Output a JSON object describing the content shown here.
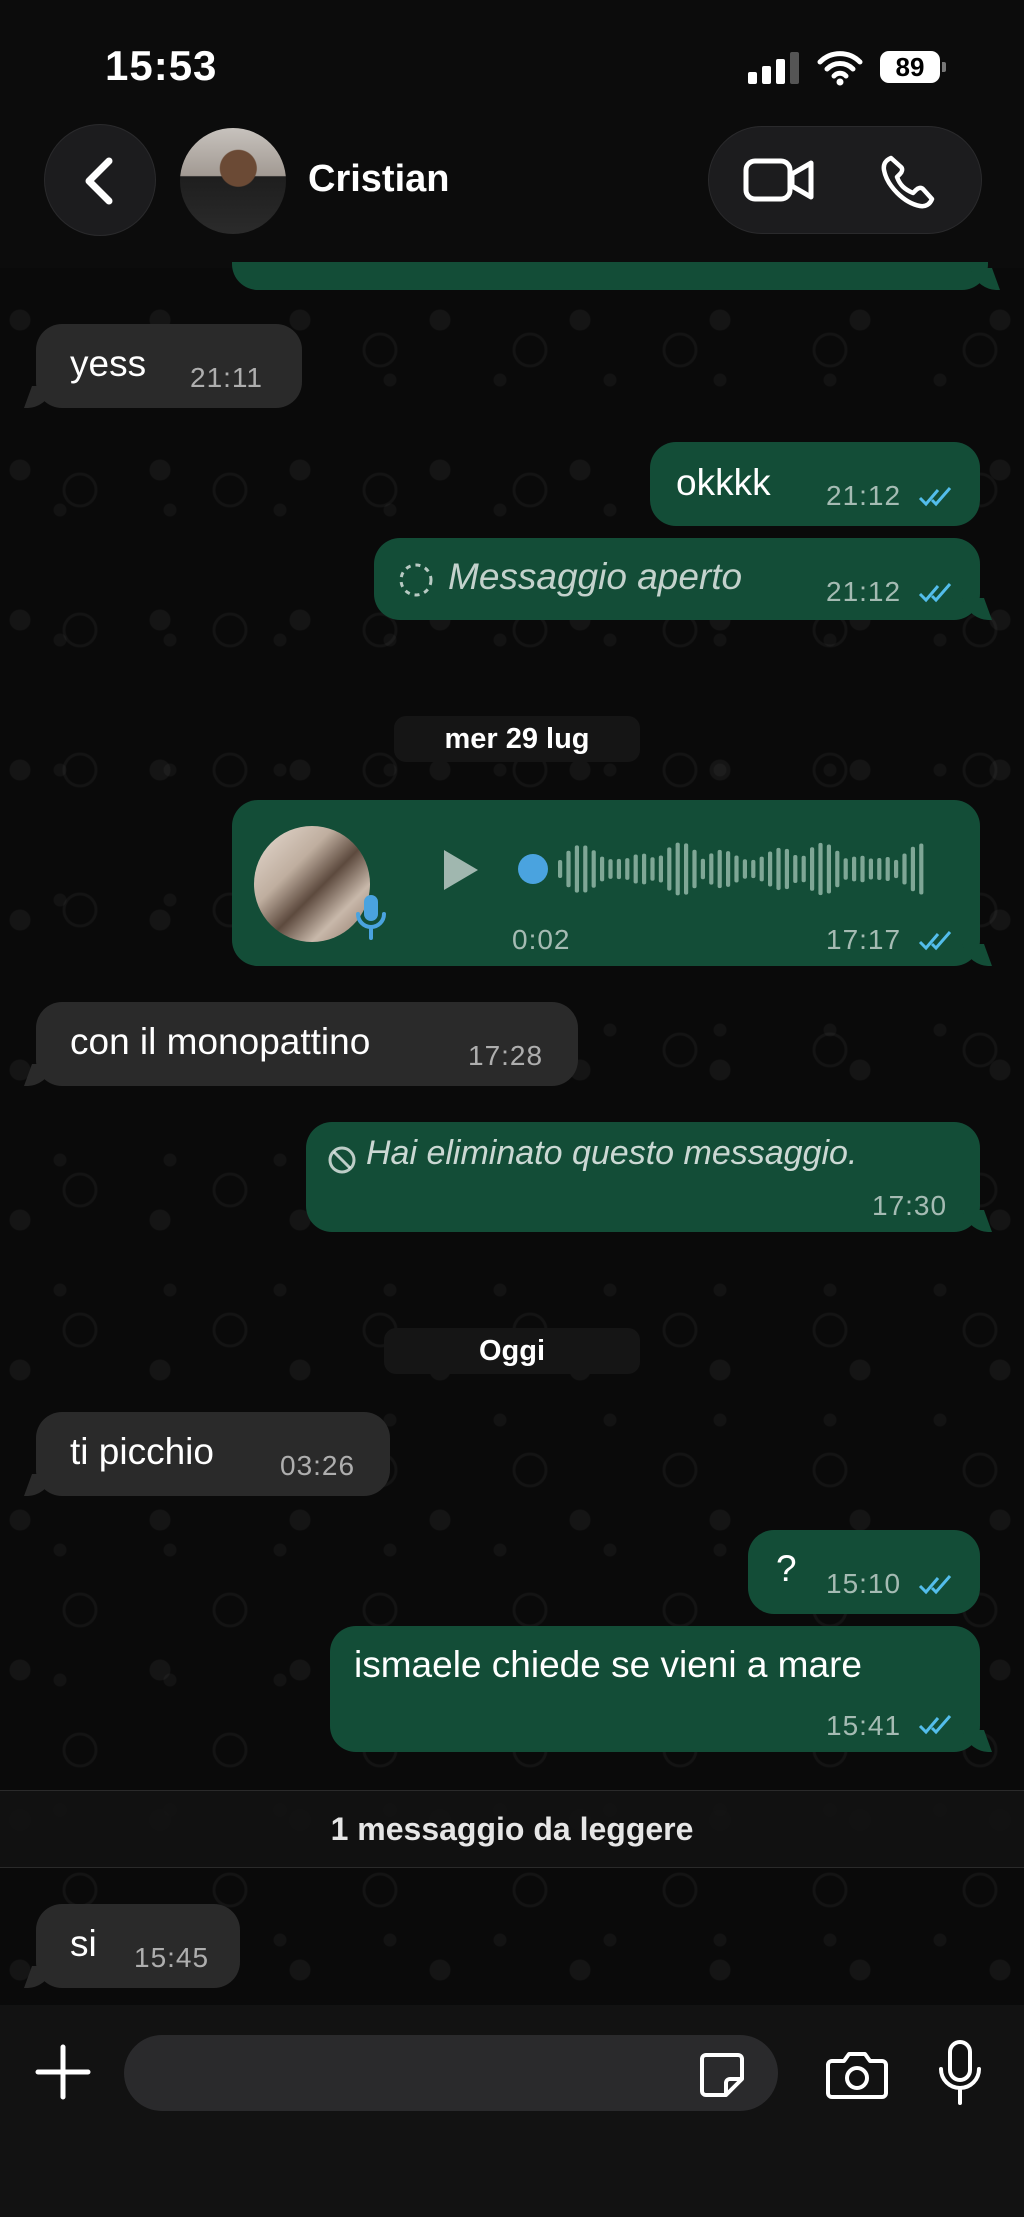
{
  "status_bar": {
    "time": "15:53",
    "battery": "89"
  },
  "header": {
    "contact_name": "Cristian"
  },
  "messages": {
    "m0": {
      "time": ""
    },
    "m1": {
      "text": "yess",
      "time": "21:11"
    },
    "m2": {
      "text": "okkkk",
      "time": "21:12"
    },
    "m3": {
      "text": "Messaggio aperto",
      "time": "21:12"
    },
    "date1": "mer 29 lug",
    "m4": {
      "duration": "0:02",
      "time": "17:17"
    },
    "m5": {
      "text": "con il monopattino",
      "time": "17:28"
    },
    "m6": {
      "text": "Hai eliminato questo messaggio.",
      "time": "17:30"
    },
    "date2": "Oggi",
    "m7": {
      "text": "ti picchio",
      "time": "03:26"
    },
    "m8": {
      "text": "?",
      "time": "15:10"
    },
    "m9": {
      "text": "ismaele chiede se vieni a mare",
      "time": "15:41"
    },
    "unread": "1 messaggio da leggere",
    "m10": {
      "text": "si",
      "time": "15:45"
    }
  },
  "input": {
    "placeholder": ""
  },
  "colors": {
    "incoming": "#2a2a2a",
    "outgoing": "#134d37",
    "read_ticks": "#53bdeb",
    "waveform": "#7fa796"
  }
}
